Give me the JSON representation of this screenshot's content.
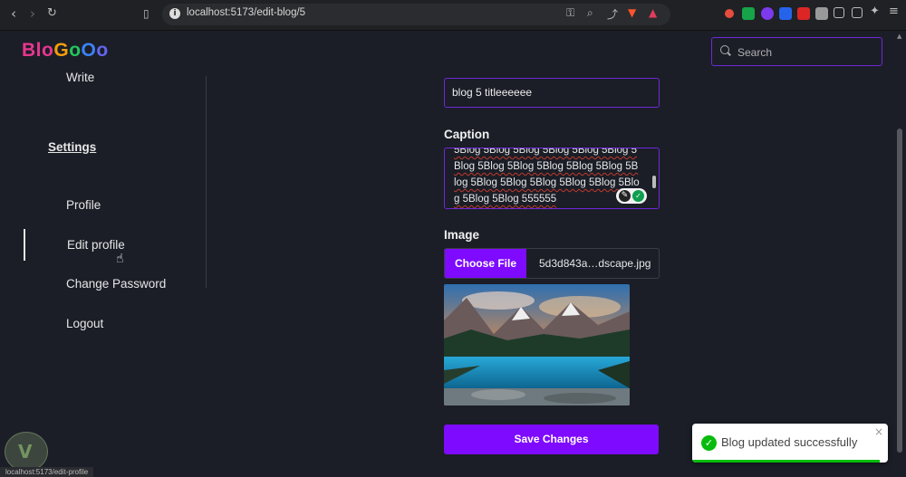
{
  "browser": {
    "url": "localhost:5173/edit-blog/5",
    "status_url": "localhost:5173/edit-profile"
  },
  "app": {
    "logo_letters": [
      {
        "char": "B",
        "color": "#e8368f"
      },
      {
        "char": "l",
        "color": "#e8368f"
      },
      {
        "char": "o",
        "color": "#e8368f"
      },
      {
        "char": "G",
        "color": "#f59e0b"
      },
      {
        "char": "o",
        "color": "#22c55e"
      },
      {
        "char": "O",
        "color": "#3b82f6"
      },
      {
        "char": "o",
        "color": "#6366f1"
      }
    ],
    "search_placeholder": "Search",
    "accent_color": "#7e0aff"
  },
  "sidebar": {
    "write": "Write",
    "settings": "Settings",
    "items": [
      {
        "label": "Profile"
      },
      {
        "label": "Edit profile"
      },
      {
        "label": "Change Password"
      },
      {
        "label": "Logout"
      }
    ]
  },
  "form": {
    "title_value": "blog 5 titleeeeee",
    "caption_label": "Caption",
    "caption_value": "5Blog 5Blog 5Blog 5Blog 5Blog 5Blog 5Blog 5Blog 5Blog 5Blog 5Blog 5Blog 5Blog 5Blog 5Blog 5Blog 5Blog 5Blog 5Blog 5Blog 5Blog 555555",
    "image_label": "Image",
    "choose_file_label": "Choose File",
    "file_name": "5d3d843a…dscape.jpg",
    "save_label": "Save Changes"
  },
  "toast": {
    "message": "Blog updated successfully",
    "close": "×",
    "progress": 0.96
  }
}
